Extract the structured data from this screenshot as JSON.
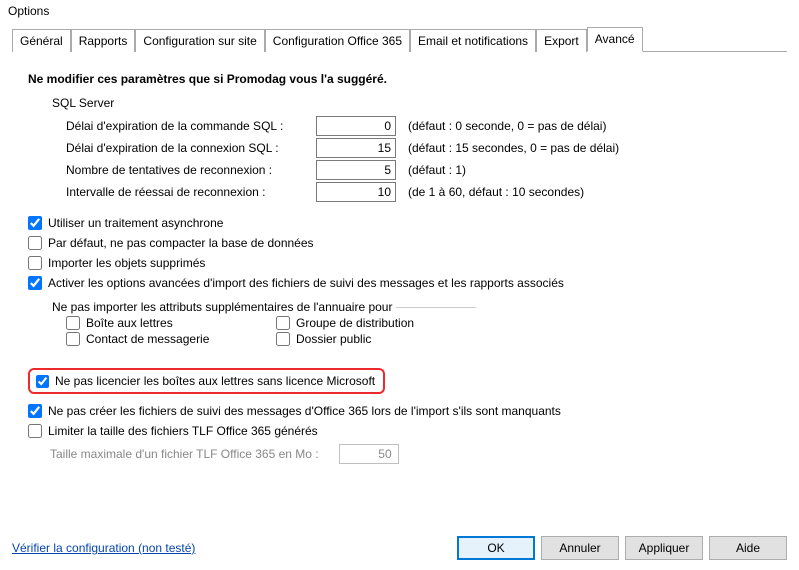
{
  "window": {
    "title": "Options"
  },
  "tabs": {
    "general": "Général",
    "reports": "Rapports",
    "site_config": "Configuration sur site",
    "o365_config": "Configuration Office 365",
    "email_notif": "Email et notifications",
    "export": "Export",
    "advanced": "Avancé"
  },
  "warning": "Ne modifier ces paramètres que si Promodag vous l'a suggéré.",
  "sql": {
    "legend": "SQL Server",
    "cmd_timeout_label": "Délai d'expiration de la commande SQL :",
    "cmd_timeout_value": "0",
    "cmd_timeout_hint": "(défaut : 0 seconde, 0 = pas de délai)",
    "conn_timeout_label": "Délai d'expiration de la connexion SQL :",
    "conn_timeout_value": "15",
    "conn_timeout_hint": "(défaut : 15 secondes, 0 = pas de délai)",
    "reconnect_attempts_label": "Nombre de tentatives de reconnexion :",
    "reconnect_attempts_value": "5",
    "reconnect_attempts_hint": "(défaut : 1)",
    "reconnect_interval_label": "Intervalle de réessai de reconnexion :",
    "reconnect_interval_value": "10",
    "reconnect_interval_hint": "(de 1 à 60, défaut : 10 secondes)"
  },
  "checkboxes": {
    "async": "Utiliser un traitement asynchrone",
    "no_compact": "Par défaut, ne pas compacter la base de données",
    "import_deleted": "Importer les objets supprimés",
    "adv_import": "Activer les options avancées d'import des fichiers de suivi des messages et les rapports associés",
    "no_license": "Ne pas licencier les boîtes aux lettres sans licence Microsoft",
    "no_create_tracking": "Ne pas créer les fichiers de suivi des messages d'Office 365 lors de l'import s'ils sont manquants",
    "limit_tlf": "Limiter la taille des fichiers TLF Office 365 générés"
  },
  "attrs_group": {
    "legend": "Ne pas importer les attributs supplémentaires de l'annuaire pour",
    "mailbox": "Boîte aux lettres",
    "dist_group": "Groupe de distribution",
    "mail_contact": "Contact de messagerie",
    "public_folder": "Dossier public"
  },
  "tlf": {
    "label": "Taille maximale d'un fichier TLF Office 365 en Mo :",
    "value": "50"
  },
  "footer": {
    "verify_link": "Vérifier la configuration (non testé)",
    "ok": "OK",
    "cancel": "Annuler",
    "apply": "Appliquer",
    "help": "Aide"
  }
}
